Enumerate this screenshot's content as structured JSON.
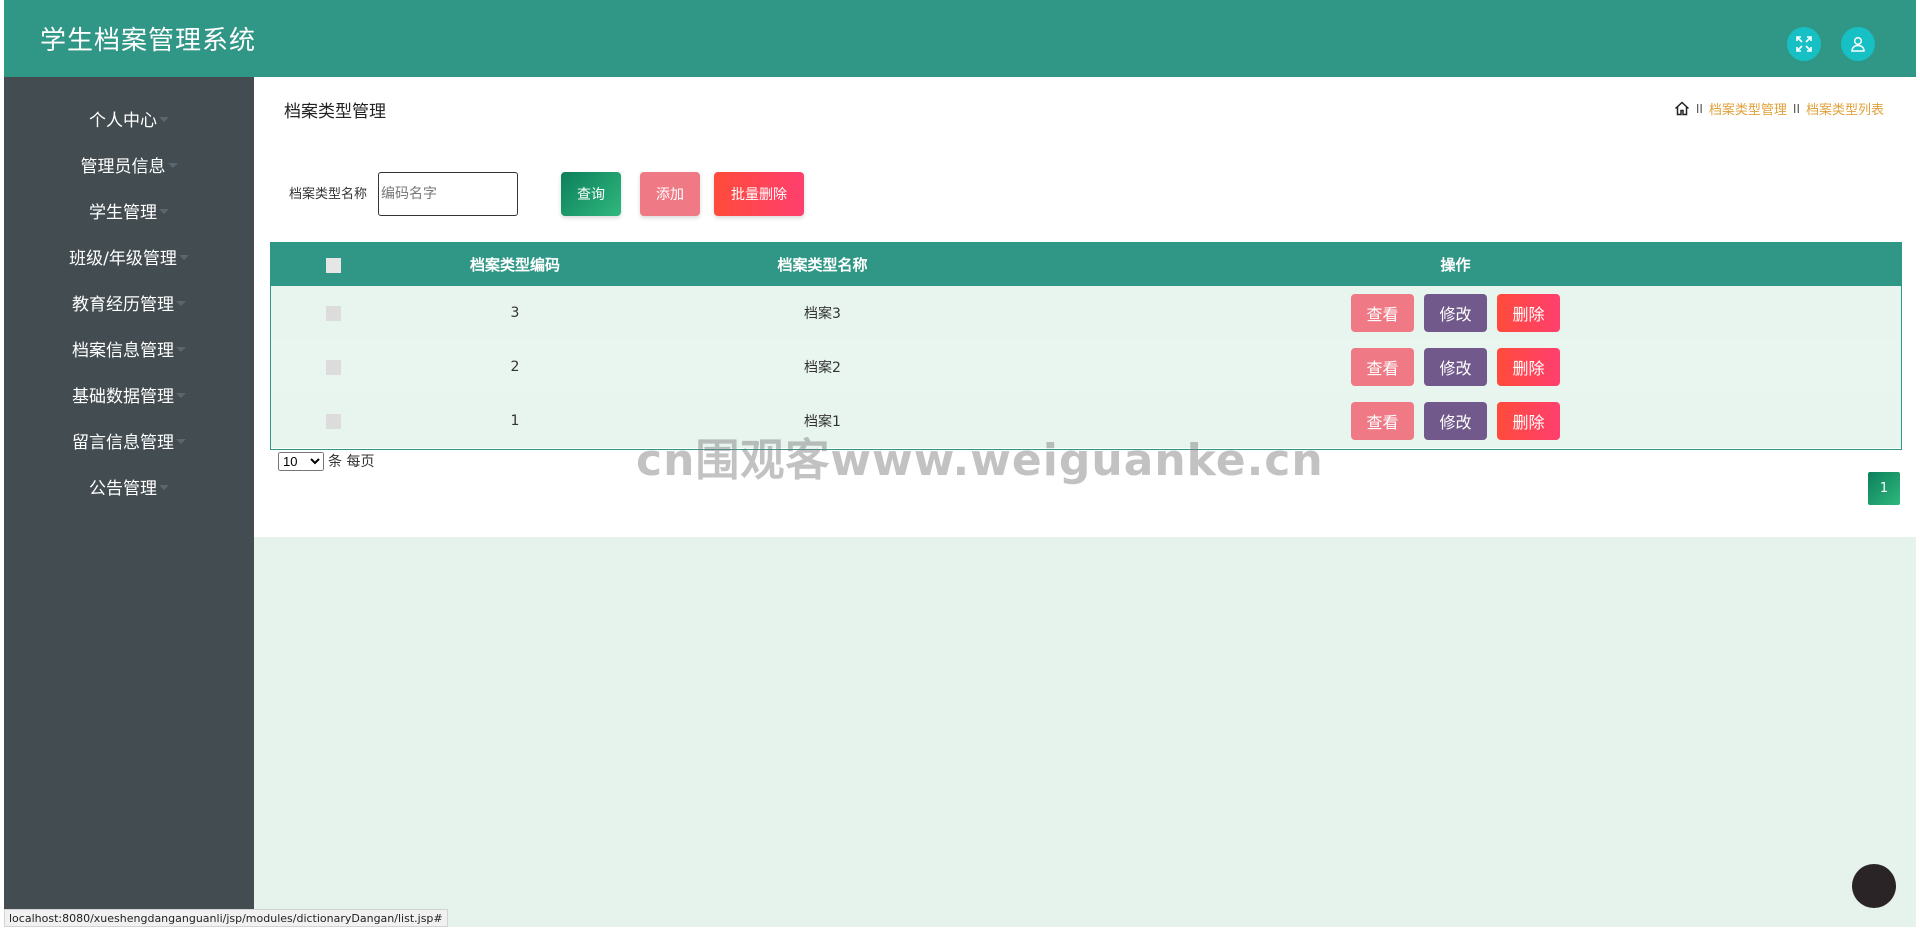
{
  "header": {
    "title": "学生档案管理系统"
  },
  "sidebar": {
    "items": [
      {
        "label": "个人中心"
      },
      {
        "label": "管理员信息"
      },
      {
        "label": "学生管理"
      },
      {
        "label": "班级/年级管理"
      },
      {
        "label": "教育经历管理"
      },
      {
        "label": "档案信息管理"
      },
      {
        "label": "基础数据管理"
      },
      {
        "label": "留言信息管理"
      },
      {
        "label": "公告管理"
      }
    ]
  },
  "main": {
    "page_title": "档案类型管理",
    "breadcrumb": {
      "sep": "II",
      "level1": "档案类型管理",
      "level2": "档案类型列表"
    },
    "search": {
      "label": "档案类型名称",
      "placeholder": "编码名字",
      "value": "",
      "query_label": "查询",
      "add_label": "添加",
      "batch_delete_label": "批量删除"
    },
    "table": {
      "columns": [
        "档案类型编码",
        "档案类型名称",
        "操作"
      ],
      "rows": [
        {
          "code": "3",
          "name": "档案3"
        },
        {
          "code": "2",
          "name": "档案2"
        },
        {
          "code": "1",
          "name": "档案1"
        }
      ],
      "actions": {
        "view": "查看",
        "edit": "修改",
        "delete": "删除"
      }
    },
    "pagination": {
      "page_size": "10",
      "per_page_label": "条 每页",
      "current_page": "1"
    }
  },
  "watermark": "cn围观客www.weiguanke.cn",
  "status_url": "localhost:8080/xueshengdanganguanli/jsp/modules/dictionaryDangan/list.jsp#",
  "colors": {
    "header": "#309786",
    "sidebar": "#434d51",
    "accent_cyan": "#16c0c4",
    "view_button": "#ef7a85",
    "edit_button": "#715a8b",
    "delete_button": "#ff4b3b",
    "breadcrumb_link": "#e0a13b"
  },
  "icons": {
    "fullscreen": "expand-icon",
    "user": "user-icon",
    "home": "home-icon",
    "caret": "caret-down-icon"
  }
}
